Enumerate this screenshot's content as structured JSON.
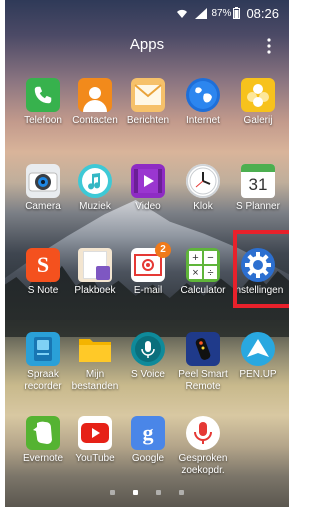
{
  "status_bar": {
    "battery_percent": "87%",
    "time": "08:26"
  },
  "header": {
    "title": "Apps"
  },
  "apps": [
    {
      "label": "Telefoon",
      "icon": "phone-icon"
    },
    {
      "label": "Contacten",
      "icon": "contacts-icon"
    },
    {
      "label": "Berichten",
      "icon": "messages-icon"
    },
    {
      "label": "Internet",
      "icon": "internet-globe-icon"
    },
    {
      "label": "Galerij",
      "icon": "gallery-icon"
    },
    {
      "label": "Camera",
      "icon": "camera-icon"
    },
    {
      "label": "Muziek",
      "icon": "music-icon"
    },
    {
      "label": "Video",
      "icon": "video-icon"
    },
    {
      "label": "Klok",
      "icon": "clock-icon"
    },
    {
      "label": "S Planner",
      "icon": "calendar-icon",
      "date": "31"
    },
    {
      "label": "S Note",
      "icon": "s-note-icon"
    },
    {
      "label": "Plakboek",
      "icon": "scrapbook-icon"
    },
    {
      "label": "E-mail",
      "icon": "email-icon",
      "badge": "2"
    },
    {
      "label": "Calculator",
      "icon": "calculator-icon"
    },
    {
      "label": "Instellingen",
      "icon": "settings-gear-icon"
    },
    {
      "label": "Spraak\nrecorder",
      "icon": "voice-recorder-icon"
    },
    {
      "label": "Mijn\nbestanden",
      "icon": "folder-icon"
    },
    {
      "label": "S Voice",
      "icon": "s-voice-icon"
    },
    {
      "label": "Peel Smart\nRemote",
      "icon": "remote-icon"
    },
    {
      "label": "PEN.UP",
      "icon": "pen-up-icon"
    },
    {
      "label": "Evernote",
      "icon": "evernote-icon"
    },
    {
      "label": "YouTube",
      "icon": "youtube-icon"
    },
    {
      "label": "Google",
      "icon": "google-icon"
    },
    {
      "label": "Gesproken\nzoekopdr.",
      "icon": "voice-search-icon"
    }
  ],
  "colors": {
    "highlight": "#e8212b",
    "badge": "#f07a1a"
  },
  "page_indicator": {
    "total": 4,
    "active_index": 1
  }
}
